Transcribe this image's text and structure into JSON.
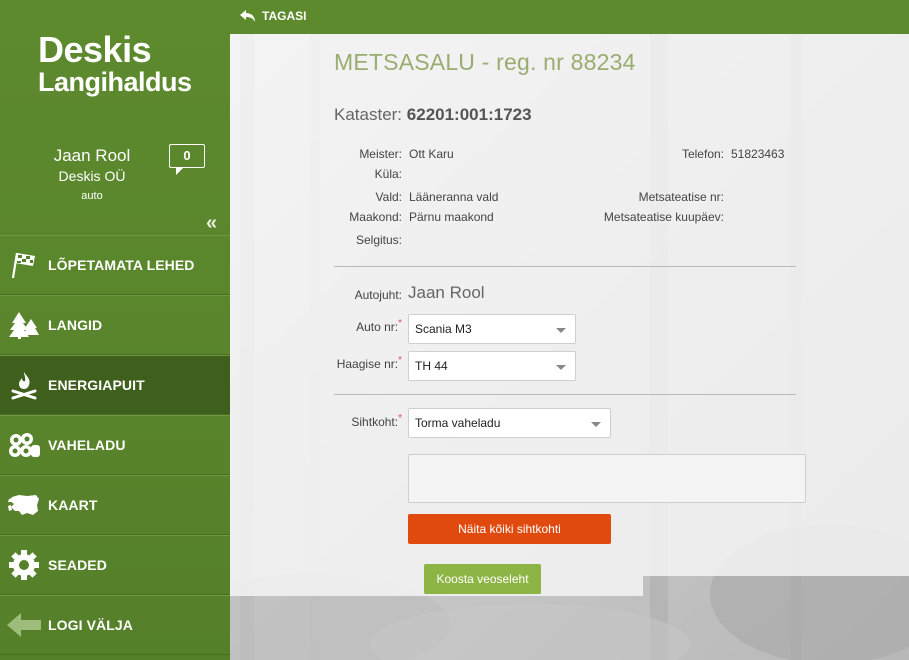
{
  "brand": {
    "line1": "Deskis",
    "line2": "Langihaldus"
  },
  "user": {
    "name": "Jaan Rool",
    "company": "Deskis OÜ",
    "role": "auto",
    "messages": "0"
  },
  "nav": [
    {
      "label": "LÕPETAMATA LEHED",
      "icon": "checkered-flag-icon"
    },
    {
      "label": "LANGID",
      "icon": "trees-icon"
    },
    {
      "label": "ENERGIAPUIT",
      "icon": "campfire-icon",
      "active": true
    },
    {
      "label": "VAHELADU",
      "icon": "logs-icon"
    },
    {
      "label": "KAART",
      "icon": "map-estonia-icon"
    },
    {
      "label": "SEADED",
      "icon": "gear-icon"
    },
    {
      "label": "LOGI VÄLJA",
      "icon": "arrow-left-icon"
    }
  ],
  "topbar": {
    "back_label": "TAGASI"
  },
  "form": {
    "title": "METSASALU - reg. nr 88234",
    "kataster_label": "Kataster:",
    "kataster_value": "62201:001:1723",
    "info": {
      "meister_label": "Meister:",
      "meister_value": "Ott Karu",
      "kyla_label": "Küla:",
      "vald_label": "Vald:",
      "vald_value": "Lääneranna vald",
      "maakond_label": "Maakond:",
      "maakond_value": "Pärnu maakond",
      "selgitus_label": "Selgitus:",
      "telefon_label": "Telefon:",
      "telefon_value": "51823463",
      "metsateatis_nr_label": "Metsateatise nr:",
      "metsateatis_kp_label": "Metsateatise kuupäev:"
    },
    "autojuht_label": "Autojuht:",
    "autojuht_value": "Jaan Rool",
    "auto_label": "Auto nr:",
    "auto_value": "Scania M3",
    "haagis_label": "Haagise nr:",
    "haagis_value": "TH 44",
    "sihtkoht_label": "Sihtkoht:",
    "sihtkoht_value": "Torma vaheladu",
    "required_mark": "*",
    "show_all_button": "Näita kõiki sihtkohti",
    "submit_button": "Koosta veoseleht"
  },
  "colors": {
    "sidebar": "#5e8a2e",
    "active_nav": "#3f5f1d",
    "title": "#98ad6f",
    "orange_button": "#e04a0f",
    "green_button": "#8db545"
  }
}
